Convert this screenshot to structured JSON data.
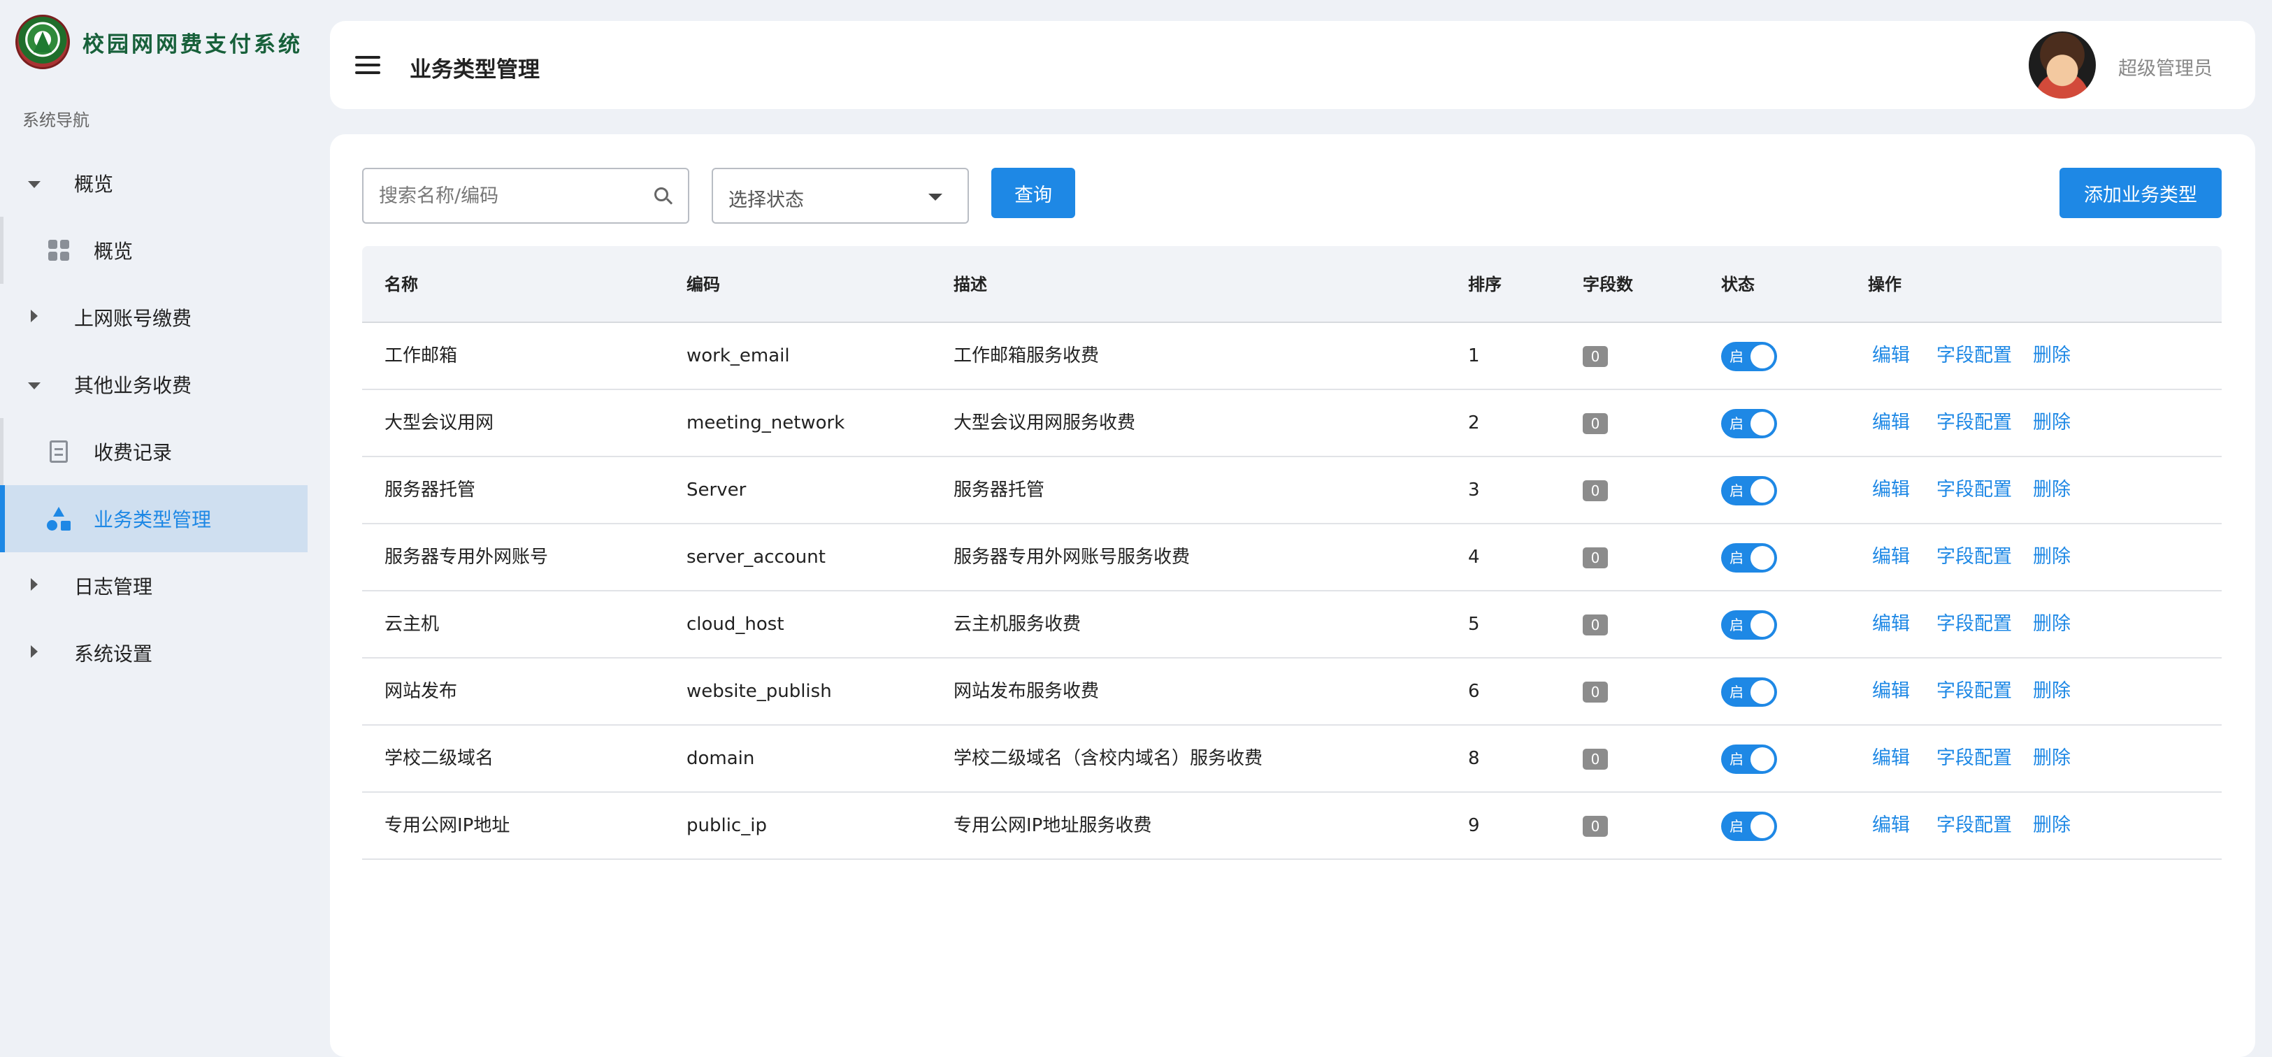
{
  "sidebar": {
    "brand_title": "校园网网费支付系统",
    "nav_caption": "系统导航",
    "items": [
      {
        "label": "概览"
      },
      {
        "label": "概览"
      },
      {
        "label": "上网账号缴费"
      },
      {
        "label": "其他业务收费"
      },
      {
        "label": "收费记录"
      },
      {
        "label": "业务类型管理"
      },
      {
        "label": "日志管理"
      },
      {
        "label": "系统设置"
      }
    ]
  },
  "header": {
    "title": "业务类型管理",
    "user_name": "超级管理员"
  },
  "toolbar": {
    "search_placeholder": "搜索名称/编码",
    "status_placeholder": "选择状态",
    "query_label": "查询",
    "add_label": "添加业务类型"
  },
  "table": {
    "headers": [
      "名称",
      "编码",
      "描述",
      "排序",
      "字段数",
      "状态",
      "操作"
    ],
    "rows": [
      {
        "name": "工作邮箱",
        "code": "work_email",
        "desc": "工作邮箱服务收费",
        "sort": "1",
        "fields": "0",
        "status": "启"
      },
      {
        "name": "大型会议用网",
        "code": "meeting_network",
        "desc": "大型会议用网服务收费",
        "sort": "2",
        "fields": "0",
        "status": "启"
      },
      {
        "name": "服务器托管",
        "code": "Server",
        "desc": "服务器托管",
        "sort": "3",
        "fields": "0",
        "status": "启"
      },
      {
        "name": "服务器专用外网账号",
        "code": "server_account",
        "desc": "服务器专用外网账号服务收费",
        "sort": "4",
        "fields": "0",
        "status": "启"
      },
      {
        "name": "云主机",
        "code": "cloud_host",
        "desc": "云主机服务收费",
        "sort": "5",
        "fields": "0",
        "status": "启"
      },
      {
        "name": "网站发布",
        "code": "website_publish",
        "desc": "网站发布服务收费",
        "sort": "6",
        "fields": "0",
        "status": "启"
      },
      {
        "name": "学校二级域名",
        "code": "domain",
        "desc": "学校二级域名（含校内域名）服务收费",
        "sort": "8",
        "fields": "0",
        "status": "启"
      },
      {
        "name": "专用公网IP地址",
        "code": "public_ip",
        "desc": "专用公网IP地址服务收费",
        "sort": "9",
        "fields": "0",
        "status": "启"
      }
    ],
    "actions": {
      "edit": "编辑",
      "fields": "字段配置",
      "delete": "删除"
    }
  },
  "colors": {
    "accent": "#1e88e5",
    "badge": "#8c8c8c",
    "active_nav_bg": "#cfdff0"
  }
}
